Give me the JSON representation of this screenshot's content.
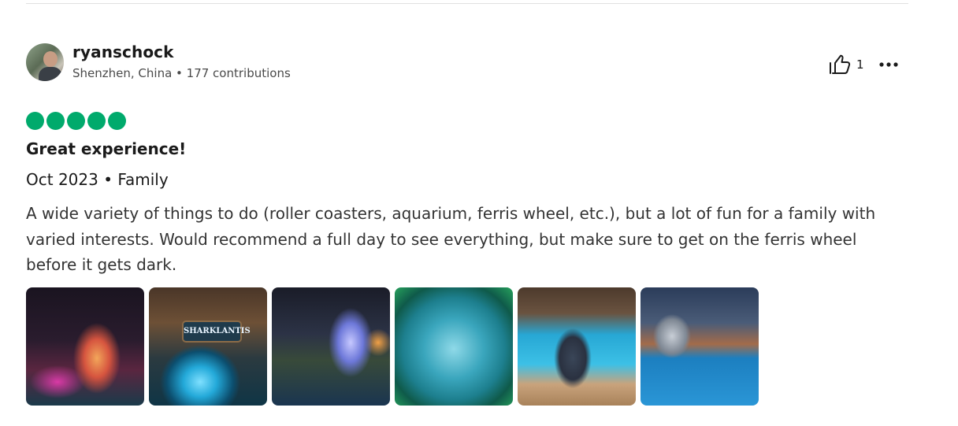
{
  "review": {
    "user": {
      "name": "ryanschock",
      "meta": "Shenzhen, China • 177 contributions"
    },
    "helpful_count": "1",
    "rating": 5,
    "title": "Great experience!",
    "trip_info": "Oct 2023 • Family",
    "text": "A wide variety of things to do (roller coasters, aquarium, ferris wheel, etc.), but a lot of fun for a family with varied interests. Would recommend a full day to see everything, but make sure to get on the ferris wheel before it gets dark.",
    "photos": [
      {
        "sign_text": ""
      },
      {
        "sign_text": "SHARKLANTIS"
      },
      {
        "sign_text": ""
      },
      {
        "sign_text": ""
      },
      {
        "sign_text": ""
      },
      {
        "sign_text": ""
      }
    ]
  },
  "colors": {
    "rating_bubble": "#00aa6c",
    "text_primary": "#1a1a1a",
    "text_secondary": "#4a4a4a"
  },
  "icons": {
    "helpful": "thumbs-up-icon",
    "more": "more-options-icon"
  }
}
